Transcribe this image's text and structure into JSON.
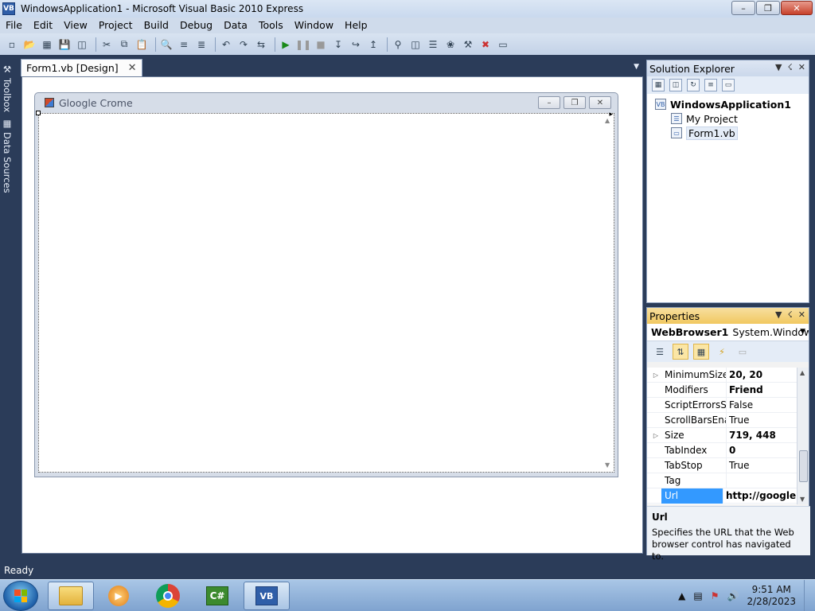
{
  "window": {
    "title": "WindowsApplication1 - Microsoft Visual Basic 2010 Express",
    "icon": "vb-app-icon",
    "controls": [
      "minimize",
      "maximize",
      "close"
    ]
  },
  "menu": [
    "File",
    "Edit",
    "View",
    "Project",
    "Build",
    "Debug",
    "Data",
    "Tools",
    "Window",
    "Help"
  ],
  "toolbar": {
    "icons": [
      "new-project-icon",
      "open-file-icon",
      "add-item-icon",
      "save-icon",
      "save-all-icon",
      "cut-icon",
      "copy-icon",
      "paste-icon",
      "find-icon",
      "comment-icon",
      "uncomment-icon",
      "undo-icon",
      "redo-icon",
      "navigate-icon",
      "start-debugging-icon",
      "pause-icon",
      "stop-icon",
      "step-into-icon",
      "step-over-icon",
      "step-out-icon",
      "find-in-files-icon",
      "solution-explorer-icon",
      "properties-icon",
      "object-browser-icon",
      "toolbox-icon",
      "error-list-icon",
      "immediate-window-icon"
    ]
  },
  "left_rail": {
    "toolbox_label": "Toolbox",
    "data_sources_label": "Data Sources"
  },
  "document": {
    "tab_label": "Form1.vb [Design]",
    "form_title": "Gloogle Crome"
  },
  "solution_explorer": {
    "title": "Solution Explorer",
    "tree": {
      "root": "WindowsApplication1",
      "children": [
        "My Project",
        "Form1.vb"
      ]
    }
  },
  "properties": {
    "title": "Properties",
    "object_name": "WebBrowser1",
    "object_type": "System.Windows.F",
    "rows": [
      {
        "name": "MinimumSize",
        "value": "20, 20",
        "expandable": true,
        "bold": true
      },
      {
        "name": "Modifiers",
        "value": "Friend",
        "expandable": false,
        "bold": true
      },
      {
        "name": "ScriptErrorsSu",
        "value": "False",
        "expandable": false,
        "bold": false
      },
      {
        "name": "ScrollBarsEnal",
        "value": "True",
        "expandable": false,
        "bold": false
      },
      {
        "name": "Size",
        "value": "719, 448",
        "expandable": true,
        "bold": true
      },
      {
        "name": "TabIndex",
        "value": "0",
        "expandable": false,
        "bold": true
      },
      {
        "name": "TabStop",
        "value": "True",
        "expandable": false,
        "bold": false
      },
      {
        "name": "Tag",
        "value": "",
        "expandable": false,
        "bold": false
      },
      {
        "name": "Url",
        "value": "http://google.c",
        "expandable": false,
        "bold": true,
        "selected": true
      }
    ],
    "description": {
      "title": "Url",
      "text": "Specifies the URL that the Web browser control has navigated to."
    }
  },
  "status": {
    "text": "Ready"
  },
  "taskbar": {
    "apps": [
      "windows-explorer",
      "media-player",
      "google-chrome",
      "visual-csharp-express",
      "visual-basic-express"
    ],
    "clock_time": "9:51 AM",
    "clock_date": "2/28/2023"
  }
}
